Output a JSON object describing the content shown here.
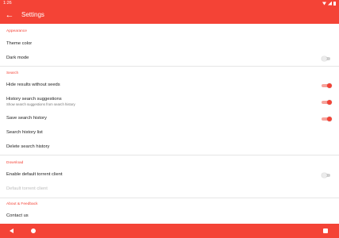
{
  "status_bar": {
    "time": "1:26"
  },
  "app_bar": {
    "title": "Settings"
  },
  "sections": {
    "appearance": {
      "header": "Appearance",
      "theme_color": "Theme color",
      "dark_mode": "Dark mode"
    },
    "search": {
      "header": "Search",
      "hide_results": "Hide results without seeds",
      "history_suggestions": "History search suggestions",
      "history_suggestions_summary": "Show search suggestions from search history",
      "save_history": "Save search history",
      "history_list": "Search history list",
      "delete_history": "Delete search history"
    },
    "download": {
      "header": "Download",
      "enable_default_client": "Enable default torrent client",
      "default_client": "Default torrent client"
    },
    "about": {
      "header": "About & Feedback",
      "contact": "Contact us"
    }
  },
  "switch_states": {
    "dark_mode": false,
    "hide_results": true,
    "history_suggestions": true,
    "save_history": true,
    "enable_default_client": false
  },
  "colors": {
    "accent": "#f44336",
    "accent_light": "#f7a39c",
    "text_primary": "#222222",
    "text_secondary": "#757575",
    "text_disabled": "#bdbdbd"
  }
}
